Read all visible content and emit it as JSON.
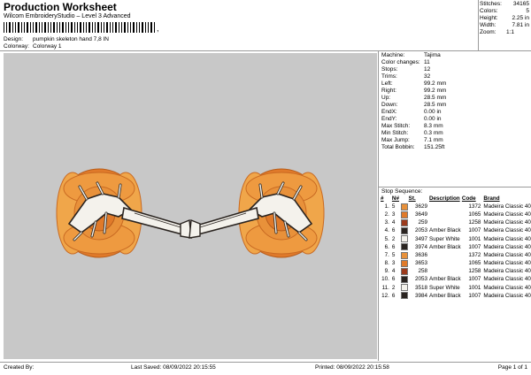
{
  "header": {
    "title": "Production Worksheet",
    "subtitle": "Wilcom EmbroideryStudio – Level 3 Advanced",
    "barcode_suffix": ",",
    "design_label": "Design:",
    "design_value": "pumpkin skeleton hand 7,8 IN",
    "colorway_label": "Colorway:",
    "colorway_value": "Colorway 1"
  },
  "stats": [
    {
      "k": "Stitches:",
      "v": "34165"
    },
    {
      "k": "Colors:",
      "v": "5"
    },
    {
      "k": "Height:",
      "v": "2.25 in"
    },
    {
      "k": "Width:",
      "v": "7.81 in"
    },
    {
      "k": "Zoom:",
      "v": "1:1"
    }
  ],
  "machine": [
    {
      "k": "Machine:",
      "v": "Tajima"
    },
    {
      "k": "Color changes:",
      "v": "11"
    },
    {
      "k": "Stops:",
      "v": "12"
    },
    {
      "k": "Trims:",
      "v": "32"
    },
    {
      "k": "Left:",
      "v": "99.2 mm"
    },
    {
      "k": "Right:",
      "v": "99.2 mm"
    },
    {
      "k": "Up:",
      "v": "28.5 mm"
    },
    {
      "k": "Down:",
      "v": "28.5 mm"
    },
    {
      "k": "EndX:",
      "v": "0.00 in"
    },
    {
      "k": "EndY:",
      "v": "0.00 in"
    },
    {
      "k": "Max Stitch:",
      "v": "8.3 mm"
    },
    {
      "k": "Min Stitch:",
      "v": "0.3 mm"
    },
    {
      "k": "Max Jump:",
      "v": "7.1 mm"
    },
    {
      "k": "Total Bobbin:",
      "v": "151.25ft"
    }
  ],
  "sequence": {
    "title": "Stop Sequence:",
    "headers": [
      "#",
      "N#",
      "St.",
      "Description",
      "Code",
      "Brand"
    ],
    "rows": [
      {
        "num": "1.",
        "n": "5",
        "color": "#e8913a",
        "st": "3629",
        "desc": "",
        "code": "1372",
        "brand": "Madeira Classic 40"
      },
      {
        "num": "2.",
        "n": "3",
        "color": "#e07a2a",
        "st": "3649",
        "desc": "",
        "code": "1065",
        "brand": "Madeira Classic 40"
      },
      {
        "num": "3.",
        "n": "4",
        "color": "#9c3a1c",
        "st": "259",
        "desc": "",
        "code": "1258",
        "brand": "Madeira Classic 40"
      },
      {
        "num": "4.",
        "n": "6",
        "color": "#2a2420",
        "st": "2053",
        "desc": "Amber Black",
        "code": "1007",
        "brand": "Madeira Classic 40"
      },
      {
        "num": "5.",
        "n": "2",
        "color": "#f4f2ec",
        "st": "3497",
        "desc": "Super White",
        "code": "1001",
        "brand": "Madeira Classic 40"
      },
      {
        "num": "6.",
        "n": "6",
        "color": "#2a2420",
        "st": "3974",
        "desc": "Amber Black",
        "code": "1007",
        "brand": "Madeira Classic 40"
      },
      {
        "num": "7.",
        "n": "5",
        "color": "#e8913a",
        "st": "3636",
        "desc": "",
        "code": "1372",
        "brand": "Madeira Classic 40"
      },
      {
        "num": "8.",
        "n": "3",
        "color": "#e07a2a",
        "st": "3653",
        "desc": "",
        "code": "1065",
        "brand": "Madeira Classic 40"
      },
      {
        "num": "9.",
        "n": "4",
        "color": "#9c3a1c",
        "st": "258",
        "desc": "",
        "code": "1258",
        "brand": "Madeira Classic 40"
      },
      {
        "num": "10.",
        "n": "6",
        "color": "#2a2420",
        "st": "2053",
        "desc": "Amber Black",
        "code": "1007",
        "brand": "Madeira Classic 40"
      },
      {
        "num": "11.",
        "n": "2",
        "color": "#f4f2ec",
        "st": "3518",
        "desc": "Super White",
        "code": "1001",
        "brand": "Madeira Classic 40"
      },
      {
        "num": "12.",
        "n": "6",
        "color": "#2a2420",
        "st": "3984",
        "desc": "Amber Black",
        "code": "1007",
        "brand": "Madeira Classic 40"
      }
    ]
  },
  "footer": {
    "created_by": "Created By:",
    "last_saved": "Last Saved: 08/09/2022 20:15:55",
    "printed": "Printed: 08/09/2022 20:15:58",
    "page": "Page 1 of 1"
  },
  "colors": {
    "preview_bg": "#c8c8c8",
    "pumpkin_light": "#f0a64a",
    "pumpkin_dark": "#e07a2a",
    "bone": "#f4f2ec",
    "outline": "#2a2420"
  }
}
